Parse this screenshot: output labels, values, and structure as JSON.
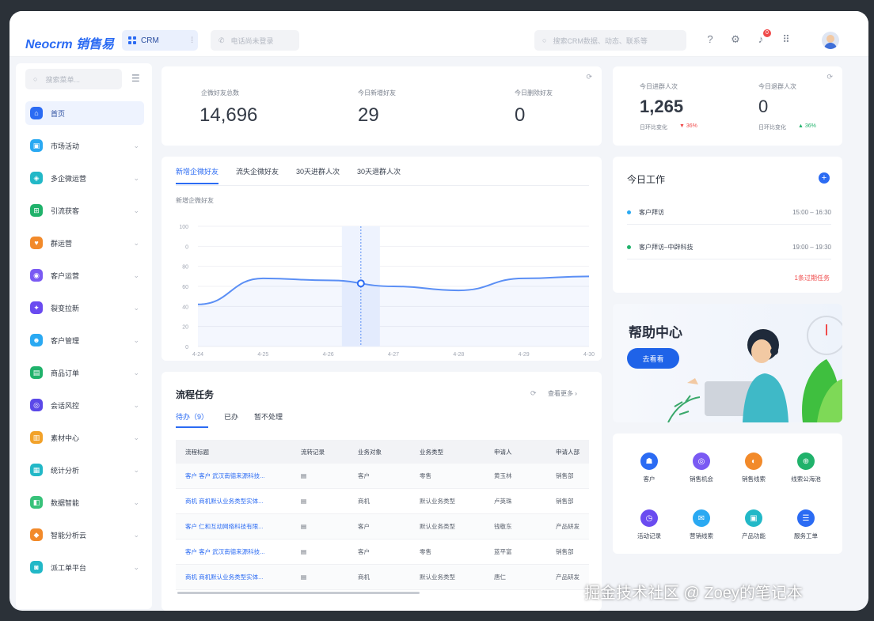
{
  "topbar": {
    "logo": "Neocrm 销售易",
    "app_name": "CRM",
    "phone_placeholder": "电话尚未登录",
    "search_placeholder": "搜索CRM数据、动态、联系等",
    "notification_count": "0"
  },
  "sidebar": {
    "search_placeholder": "搜索菜单...",
    "items": [
      {
        "label": "首页",
        "color": "#2b6bf3",
        "active": true
      },
      {
        "label": "市场活动",
        "color": "#2aa9f2"
      },
      {
        "label": "多企微运营",
        "color": "#22b8c7"
      },
      {
        "label": "引流获客",
        "color": "#20b26b"
      },
      {
        "label": "群运营",
        "color": "#f28a2a"
      },
      {
        "label": "客户运营",
        "color": "#7a5af3"
      },
      {
        "label": "裂变拉新",
        "color": "#6a4bf0"
      },
      {
        "label": "客户管理",
        "color": "#2aa9f2"
      },
      {
        "label": "商品订单",
        "color": "#20b26b"
      },
      {
        "label": "会话风控",
        "color": "#5b48e8"
      },
      {
        "label": "素材中心",
        "color": "#f2a22a"
      },
      {
        "label": "统计分析",
        "color": "#22b8c7"
      },
      {
        "label": "数据智能",
        "color": "#38c27a"
      },
      {
        "label": "智能分析云",
        "color": "#f28a2a"
      },
      {
        "label": "派工单平台",
        "color": "#22b8c7"
      }
    ]
  },
  "stats": [
    {
      "label": "企微好友总数",
      "value": "14,696"
    },
    {
      "label": "今日新增好友",
      "value": "29"
    },
    {
      "label": "今日删除好友",
      "value": "0"
    }
  ],
  "group_stats": [
    {
      "label": "今日进群人次",
      "value": "1,265",
      "compare_label": "日环比变化",
      "change": "▼ 36%",
      "change_color": "#f04b4b"
    },
    {
      "label": "今日退群人次",
      "value": "0",
      "compare_label": "日环比变化",
      "change": "▲ 36%",
      "change_color": "#20b26b"
    }
  ],
  "chart_tabs": [
    "新增企微好友",
    "流失企微好友",
    "30天进群人次",
    "30天退群人次"
  ],
  "chart_data": {
    "type": "line",
    "title": "新增企微好友",
    "categories": [
      "4-24",
      "4-25",
      "4-26",
      "4-27",
      "4-28",
      "4-29",
      "4-30"
    ],
    "y_ticks": [
      "100",
      "0",
      "80",
      "60",
      "40",
      "20",
      "0"
    ],
    "ylim": [
      0,
      120
    ],
    "series": [
      {
        "values": [
          42,
          68,
          66,
          60,
          56,
          68,
          70
        ]
      }
    ],
    "highlight_index": 2
  },
  "tasks": {
    "title": "流程任务",
    "more": "查看更多 ›",
    "tabs": [
      "待办（9）",
      "已办",
      "暂不处理"
    ],
    "columns": [
      "流程标题",
      "流转记录",
      "业务对象",
      "业务类型",
      "申请人",
      "申请人部"
    ],
    "rows": [
      [
        "客户 客户 武汉南德来源科技...",
        "客户",
        "零售",
        "黄玉林",
        "销售部"
      ],
      [
        "商机 商机默认业务类型实体...",
        "商机",
        "默认业务类型",
        "卢英珠",
        "销售部"
      ],
      [
        "客户 仁和互动网络科技有限...",
        "客户",
        "默认业务类型",
        "钱敬东",
        "产品研发"
      ],
      [
        "客户 客户 武汉南德来源科技...",
        "客户",
        "零售",
        "蓝平富",
        "销售部"
      ],
      [
        "商机 商机默认业务类型实体...",
        "商机",
        "默认业务类型",
        "唐仁",
        "产品研发"
      ]
    ]
  },
  "work": {
    "title": "今日工作",
    "items": [
      {
        "label": "客户拜访",
        "time": "15:00 – 16:30",
        "color": "#2aa9f2"
      },
      {
        "label": "客户拜访–中辟科技",
        "time": "19:00 – 19:30",
        "color": "#20b26b"
      }
    ],
    "footer": "1条过期任务"
  },
  "help": {
    "title": "帮助中心",
    "button": "去看看"
  },
  "quick_links": [
    {
      "label": "客户",
      "color": "#2b6bf3"
    },
    {
      "label": "销售机会",
      "color": "#7a5af3"
    },
    {
      "label": "销售线索",
      "color": "#f28a2a"
    },
    {
      "label": "线索公海池",
      "color": "#20b26b"
    },
    {
      "label": "活动记录",
      "color": "#6a4bf0"
    },
    {
      "label": "营销线索",
      "color": "#2aa9f2"
    },
    {
      "label": "产品功能",
      "color": "#22b8c7"
    },
    {
      "label": "服务工单",
      "color": "#2b6bf3"
    }
  ],
  "watermark": "掘金技术社区 @ Zoey的笔记本"
}
